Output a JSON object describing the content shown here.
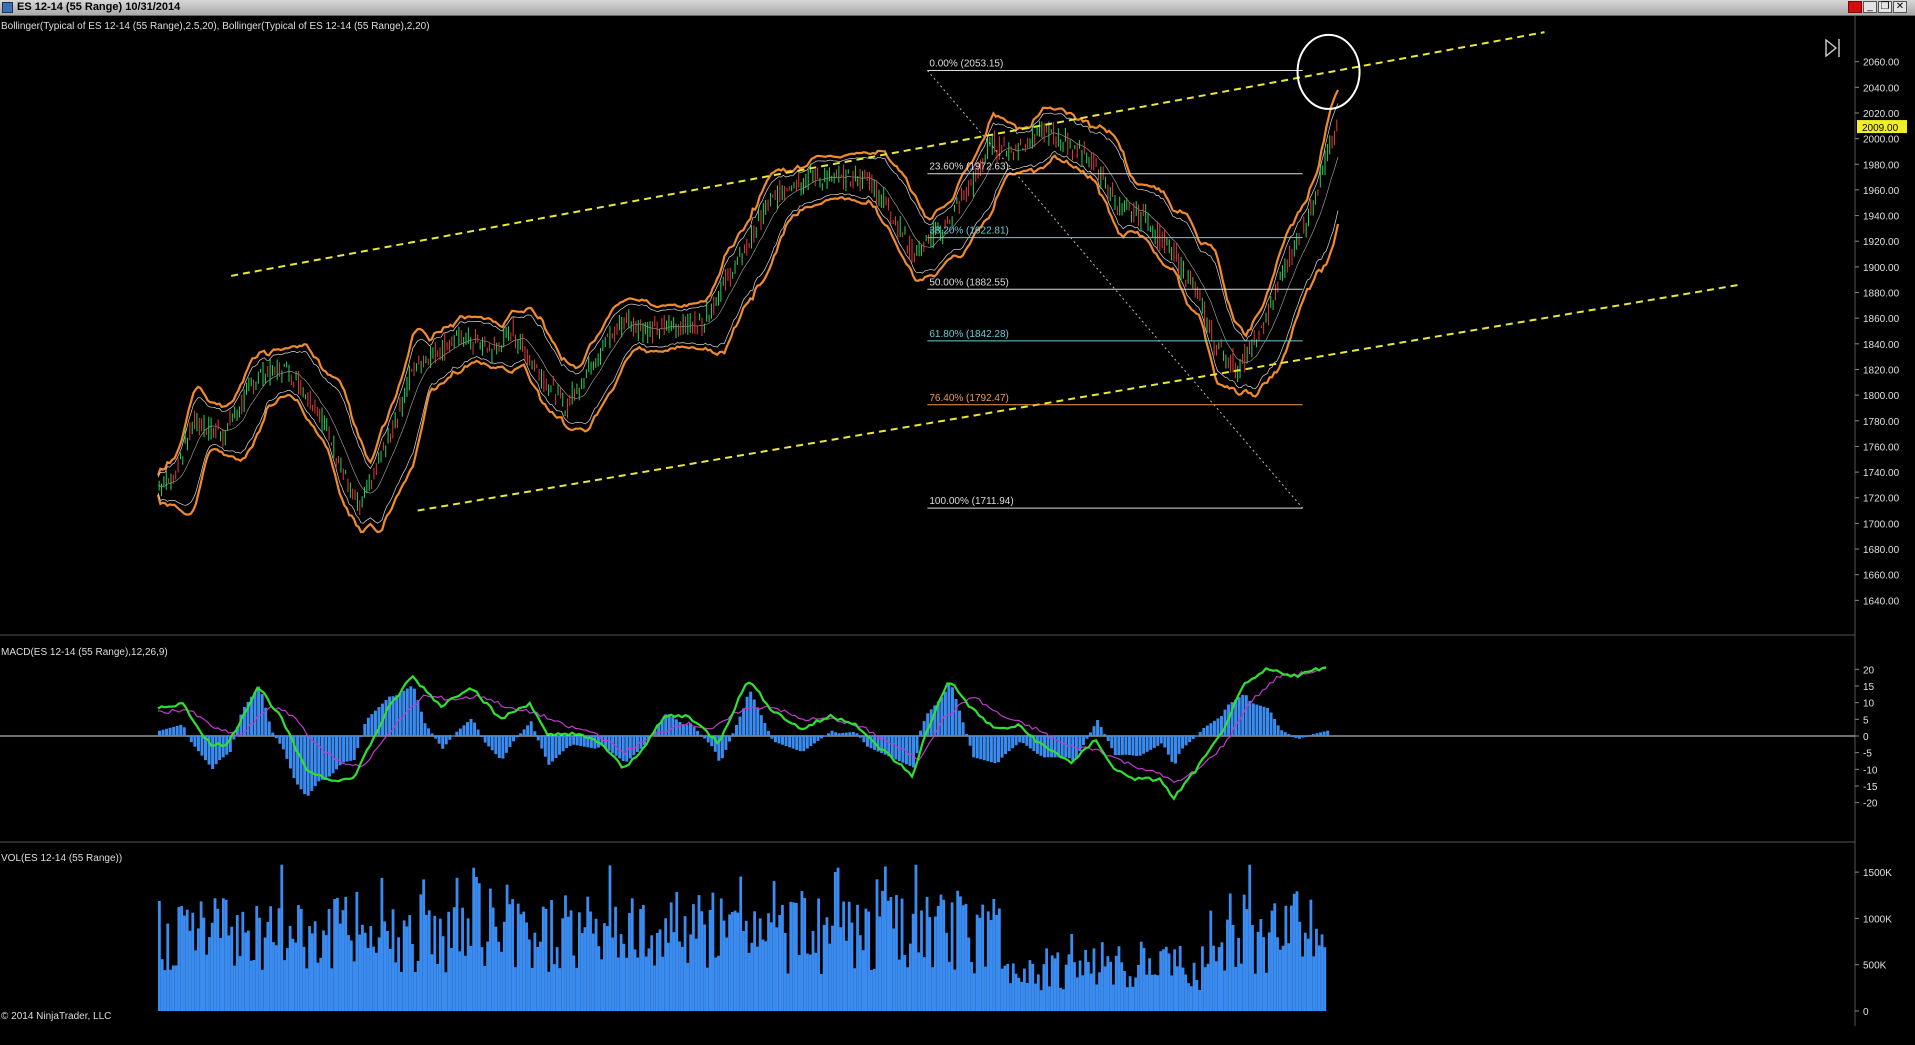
{
  "window": {
    "title": "ES 12-14 (55 Range)  10/31/2014",
    "buttons": {
      "minimize": "_",
      "restore": "❐",
      "close": "✕"
    }
  },
  "panels": {
    "price_label": "Bollinger(Typical of ES 12-14 (55 Range),2.5,20), Bollinger(Typical of ES 12-14 (55 Range),2,20)",
    "macd_label": "MACD(ES 12-14 (55 Range),12,26,9)",
    "vol_label": "VOL(ES 12-14 (55 Range))"
  },
  "copyright": "© 2014 NinjaTrader, LLC",
  "colors": {
    "background": "#000000",
    "candle_up": "#2bd25a",
    "candle_down": "#e33b3b",
    "bollinger_outer": "#f08a2c",
    "bollinger_inner": "#d8d8d8",
    "channel": "#e8e83a",
    "macd": "#30e030",
    "signal": "#c03acb",
    "histogram": "#3a8cf0",
    "volume": "#3a8cf0",
    "current_price_bg": "#f0f020"
  },
  "icons": {
    "play_end": "play-end-icon"
  },
  "chart_data": [
    {
      "type": "candlestick",
      "panel": "price",
      "y_axis": {
        "ticks": [
          1640,
          1660,
          1680,
          1700,
          1720,
          1740,
          1760,
          1780,
          1800,
          1820,
          1840,
          1860,
          1880,
          1900,
          1920,
          1940,
          1960,
          1980,
          2000,
          2020,
          2040,
          2060
        ]
      },
      "ylim": [
        1620,
        2080
      ],
      "last_price": "2009.00",
      "close_path": [
        [
          0,
          1730
        ],
        [
          12,
          1735
        ],
        [
          30,
          1780
        ],
        [
          55,
          1770
        ],
        [
          85,
          1815
        ],
        [
          110,
          1820
        ],
        [
          135,
          1790
        ],
        [
          155,
          1745
        ],
        [
          170,
          1710
        ],
        [
          195,
          1765
        ],
        [
          215,
          1820
        ],
        [
          235,
          1835
        ],
        [
          260,
          1845
        ],
        [
          285,
          1835
        ],
        [
          300,
          1850
        ],
        [
          325,
          1815
        ],
        [
          345,
          1790
        ],
        [
          370,
          1830
        ],
        [
          395,
          1860
        ],
        [
          415,
          1850
        ],
        [
          440,
          1855
        ],
        [
          460,
          1855
        ],
        [
          475,
          1880
        ],
        [
          495,
          1910
        ],
        [
          515,
          1945
        ],
        [
          535,
          1965
        ],
        [
          555,
          1970
        ],
        [
          575,
          1968
        ],
        [
          600,
          1970
        ],
        [
          620,
          1945
        ],
        [
          640,
          1910
        ],
        [
          665,
          1930
        ],
        [
          690,
          1965
        ],
        [
          705,
          1995
        ],
        [
          725,
          1990
        ],
        [
          745,
          2005
        ],
        [
          765,
          2000
        ],
        [
          790,
          1985
        ],
        [
          815,
          1945
        ],
        [
          835,
          1940
        ],
        [
          860,
          1910
        ],
        [
          880,
          1880
        ],
        [
          895,
          1840
        ],
        [
          915,
          1820
        ],
        [
          935,
          1850
        ],
        [
          955,
          1900
        ],
        [
          975,
          1940
        ],
        [
          990,
          1985
        ],
        [
          1000,
          2009
        ]
      ],
      "channel_upper": [
        [
          62,
          1893
        ],
        [
          1175,
          2083
        ]
      ],
      "channel_lower": [
        [
          220,
          1710
        ],
        [
          1340,
          1886
        ]
      ],
      "fibonacci": {
        "start_x": 652,
        "end_x": 970,
        "levels": [
          {
            "label": "0.00% (2053.15)",
            "value": 2053.15,
            "color": "#dcdcdc"
          },
          {
            "label": "23.60% (1972.63)",
            "value": 1972.63,
            "color": "#dcdcdc"
          },
          {
            "label": "38.20% (1922.81)",
            "value": 1922.81,
            "color": "#6fc9d8"
          },
          {
            "label": "50.00% (1882.55)",
            "value": 1882.55,
            "color": "#dcdcdc"
          },
          {
            "label": "61.80% (1842.28)",
            "value": 1842.28,
            "color": "#6fc9d8"
          },
          {
            "label": "76.40% (1792.47)",
            "value": 1792.47,
            "color": "#f09a48"
          },
          {
            "label": "100.00% (1711.94)",
            "value": 1711.94,
            "color": "#dcdcdc"
          }
        ]
      },
      "annotation_circle": {
        "x": 992,
        "y": 2052
      }
    },
    {
      "type": "line",
      "panel": "macd",
      "y_axis": {
        "ticks": [
          20,
          15,
          10,
          5,
          0,
          -5,
          -10,
          -15,
          -20
        ]
      },
      "ylim": [
        -24,
        24
      ],
      "macd": [
        [
          0,
          8
        ],
        [
          20,
          10
        ],
        [
          45,
          -3
        ],
        [
          60,
          -2
        ],
        [
          85,
          15
        ],
        [
          105,
          5
        ],
        [
          125,
          -10
        ],
        [
          145,
          -13
        ],
        [
          165,
          -13
        ],
        [
          195,
          8
        ],
        [
          215,
          18
        ],
        [
          240,
          9
        ],
        [
          265,
          15
        ],
        [
          290,
          5
        ],
        [
          315,
          10
        ],
        [
          330,
          0
        ],
        [
          350,
          1
        ],
        [
          375,
          -2
        ],
        [
          395,
          -10
        ],
        [
          410,
          -4
        ],
        [
          430,
          6
        ],
        [
          450,
          6
        ],
        [
          475,
          -2
        ],
        [
          500,
          17
        ],
        [
          520,
          8
        ],
        [
          545,
          2
        ],
        [
          570,
          6
        ],
        [
          590,
          4
        ],
        [
          600,
          0
        ],
        [
          620,
          -6
        ],
        [
          640,
          -12
        ],
        [
          650,
          0
        ],
        [
          670,
          17
        ],
        [
          690,
          8
        ],
        [
          710,
          2
        ],
        [
          730,
          3
        ],
        [
          750,
          -3
        ],
        [
          775,
          -8
        ],
        [
          795,
          -1
        ],
        [
          810,
          -10
        ],
        [
          830,
          -13
        ],
        [
          850,
          -13
        ],
        [
          860,
          -19
        ],
        [
          880,
          -10
        ],
        [
          900,
          0
        ],
        [
          920,
          15
        ],
        [
          940,
          20
        ],
        [
          965,
          18
        ],
        [
          990,
          21
        ]
      ],
      "signal": [
        [
          0,
          7
        ],
        [
          25,
          8
        ],
        [
          50,
          2
        ],
        [
          70,
          0
        ],
        [
          95,
          9
        ],
        [
          115,
          6
        ],
        [
          135,
          -3
        ],
        [
          155,
          -8
        ],
        [
          175,
          -9
        ],
        [
          200,
          3
        ],
        [
          225,
          12
        ],
        [
          250,
          11
        ],
        [
          275,
          12
        ],
        [
          300,
          8
        ],
        [
          320,
          7
        ],
        [
          345,
          3
        ],
        [
          370,
          1
        ],
        [
          395,
          -5
        ],
        [
          420,
          0
        ],
        [
          445,
          4
        ],
        [
          470,
          2
        ],
        [
          495,
          8
        ],
        [
          520,
          9
        ],
        [
          545,
          5
        ],
        [
          575,
          5
        ],
        [
          600,
          2
        ],
        [
          625,
          -3
        ],
        [
          645,
          -7
        ],
        [
          665,
          5
        ],
        [
          690,
          12
        ],
        [
          715,
          6
        ],
        [
          745,
          2
        ],
        [
          770,
          -3
        ],
        [
          795,
          -4
        ],
        [
          820,
          -8
        ],
        [
          845,
          -11
        ],
        [
          865,
          -14
        ],
        [
          885,
          -9
        ],
        [
          905,
          -2
        ],
        [
          925,
          10
        ],
        [
          950,
          18
        ],
        [
          975,
          19
        ],
        [
          990,
          20
        ]
      ]
    },
    {
      "type": "bar",
      "panel": "volume",
      "y_axis": {
        "ticks": [
          "1500K",
          "1000K",
          "500K",
          "0"
        ]
      },
      "ylim": [
        0,
        1620
      ],
      "bar_count": 420
    }
  ]
}
